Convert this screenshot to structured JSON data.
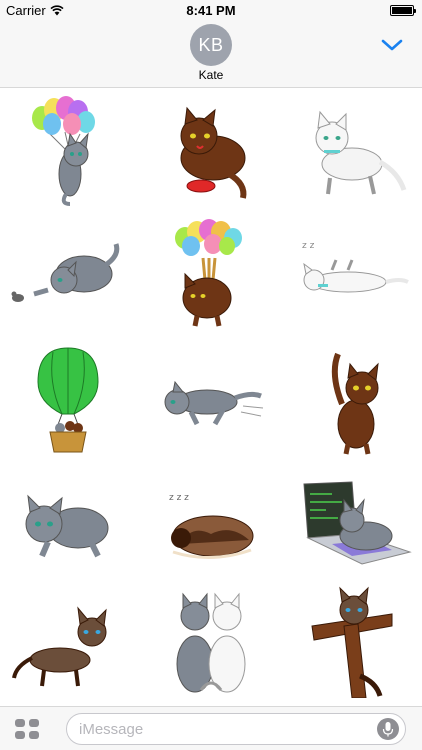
{
  "status_bar": {
    "carrier": "Carrier",
    "time": "8:41 PM",
    "battery_level": 1.0
  },
  "header": {
    "avatar_initials": "KB",
    "contact_name": "Kate",
    "collapse_icon": "chevron-down-icon",
    "accent_color": "#1a82f0"
  },
  "stickers": [
    "gray cat with balloons",
    "brown cat with red bowl",
    "white cat walking",
    "gray cat with mouse",
    "brown cat with balloons",
    "white cat sleeping",
    "hot air balloon with cats",
    "gray cat leaping",
    "brown cat sitting",
    "gray cat crouching",
    "brown cat sleeping",
    "gray cat on laptop",
    "siamese cat walking",
    "two cats back view",
    "siamese cat climbing tree"
  ],
  "compose": {
    "placeholder": "iMessage",
    "apps_icon": "apps-grid-icon",
    "mic_icon": "microphone-icon"
  }
}
